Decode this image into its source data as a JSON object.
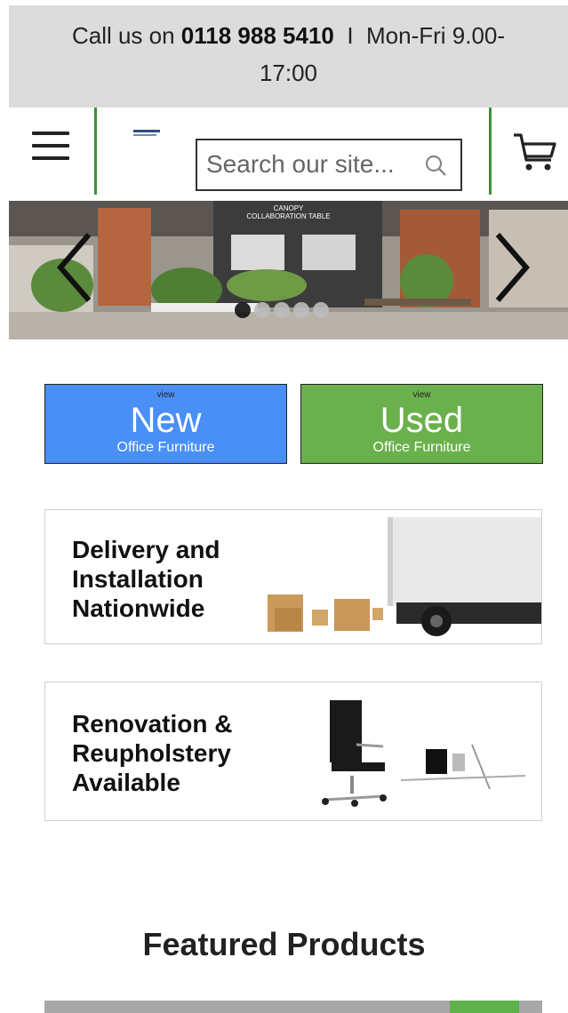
{
  "topbar": {
    "prefix": "Call us on ",
    "phone": "0118 988 5410",
    "sep": "  I  ",
    "hours_line1": "Mon-Fri 9.00-",
    "hours_line2": "17:00"
  },
  "header": {
    "menu_icon": "hamburger-icon",
    "search": {
      "placeholder": "Search our site...",
      "icon": "search-icon"
    },
    "cart_icon": "shopping-cart-icon"
  },
  "slider": {
    "caption_line1": "CANOPY",
    "caption_line2": "COLLABORATION TABLE",
    "prev_icon": "chevron-left-icon",
    "next_icon": "chevron-right-icon",
    "slide_count": 5,
    "active_slide": 1
  },
  "categories": [
    {
      "view": "view",
      "title": "New",
      "subtitle": "Office Furniture",
      "color": "#4a8ff5"
    },
    {
      "view": "view",
      "title": "Used",
      "subtitle": "Office Furniture",
      "color": "#6ab04c"
    }
  ],
  "banners": [
    {
      "line1": "Delivery and",
      "line2": "Installation",
      "line3": "Nationwide"
    },
    {
      "line1": "Renovation &",
      "line2": "Reupholstery",
      "line3": "Available"
    }
  ],
  "featured": {
    "heading": "Featured Products"
  }
}
